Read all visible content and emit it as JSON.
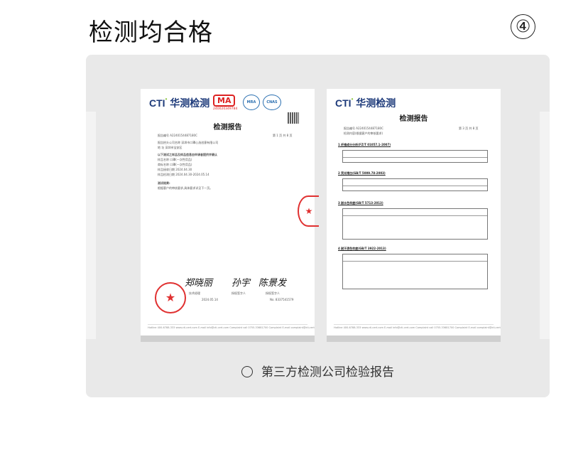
{
  "header": {
    "title": "检测均合格",
    "step_number": "④"
  },
  "caption": "第三方检测公司检验报告",
  "documents": [
    {
      "logo": "CTI",
      "logo_cn": "华测检测",
      "cma": "MA",
      "cma_number": "240020349784",
      "title": "检测报告",
      "report_no": "报告编号  A2240154487180C",
      "page": "第 1 页  共 8 页",
      "lines": [
        "报告抬头公司名称  深圳市口罩心选创意有限公司",
        "地    址  深圳市宝安区",
        "以下测试之样品及样品信息由申请者提供并确认",
        "样品名称  口罩(一次性用品)",
        "商标名称  口罩(一次性用品)",
        "样品接收日期  2024.04.30",
        "样品检测日期  2024.04.30-2024.05.14",
        "测试结果:",
        "根据客户的审核要求,具体要求详见下一页。"
      ],
      "signers": [
        "郑晓丽",
        "孙宇",
        "陈景发"
      ],
      "sign_roles": [
        "技术经理",
        "授权签字人",
        "授权签字人"
      ],
      "date": "2024.05.14",
      "no": "No. 8337541579",
      "footer": "Hotline 400-6788-333   www.cti-cert.com   E-mail info@cti-cert.com   Complaint call 0755-33681700   Complaint E-mail complaint@cti-cert.com"
    },
    {
      "logo": "CTI",
      "logo_cn": "华测检测",
      "title": "检测报告",
      "report_no": "报告编号  A2240154487180C",
      "page": "第 3 页  共 8 页",
      "content_label": "检测内容(根据客户的审核要求)",
      "sections": [
        "1  纤维成分分析(FZ/T 01057.1-2007)",
        "2  荧光增白(GB/T 5009.78-2003)",
        "3  耐水色牢度(GB/T 5713-2013)",
        "4  耐汗渍色牢度(GB/T 3922-2013)"
      ],
      "footer": "Hotline 400-6788-333   www.cti-cert.com   E-mail info@cti-cert.com   Complaint call 0755-33681700   Complaint E-mail complaint@cti-cert.com"
    }
  ]
}
